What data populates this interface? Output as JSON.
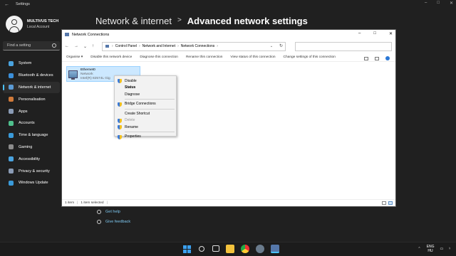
{
  "settings": {
    "title": "Settings",
    "user": {
      "name": "MULTIVUS TECH",
      "account": "Local Account"
    },
    "search_placeholder": "Find a setting",
    "nav": [
      {
        "label": "System",
        "color": "#4aa3df"
      },
      {
        "label": "Bluetooth & devices",
        "color": "#3b8fd9"
      },
      {
        "label": "Network & internet",
        "color": "#5b9bd5",
        "active": true
      },
      {
        "label": "Personalisation",
        "color": "#d07a3a"
      },
      {
        "label": "Apps",
        "color": "#8a9bb5"
      },
      {
        "label": "Accounts",
        "color": "#4fc08d"
      },
      {
        "label": "Time & language",
        "color": "#3a9ad9"
      },
      {
        "label": "Gaming",
        "color": "#8c8c8c"
      },
      {
        "label": "Accessibility",
        "color": "#4aa3df"
      },
      {
        "label": "Privacy & security",
        "color": "#8a9bb5"
      },
      {
        "label": "Windows Update",
        "color": "#3a9ad9"
      }
    ],
    "breadcrumb": {
      "parent": "Network & internet",
      "separator": ">",
      "current": "Advanced network settings"
    },
    "links": {
      "help": "Get help",
      "feedback": "Give feedback"
    }
  },
  "window": {
    "title": "Network Connections",
    "address": [
      "Control Panel",
      "Network and Internet",
      "Network Connections"
    ],
    "commands": [
      "Organise ▾",
      "Disable this network device",
      "Diagnose this connection",
      "Rename this connection",
      "View status of this connection",
      "Change settings of this connection"
    ],
    "item": {
      "name": "Ethernet0",
      "type": "Network",
      "device": "Intel(R) 82574L Gig"
    },
    "status": {
      "count": "1 item",
      "selected": "1 item selected"
    }
  },
  "context_menu": {
    "items": [
      {
        "label": "Disable",
        "icon": "shield"
      },
      {
        "label": "Status",
        "bold": true
      },
      {
        "label": "Diagnose"
      },
      {
        "sep": true
      },
      {
        "label": "Bridge Connections",
        "icon": "shield"
      },
      {
        "sep": true
      },
      {
        "label": "Create Shortcut"
      },
      {
        "label": "Delete",
        "icon": "shield",
        "disabled": true
      },
      {
        "label": "Rename",
        "icon": "shield"
      },
      {
        "sep": true
      },
      {
        "label": "Properties",
        "icon": "shield"
      }
    ]
  },
  "taskbar": {
    "lang_top": "ENG",
    "lang_bottom": "HU"
  }
}
